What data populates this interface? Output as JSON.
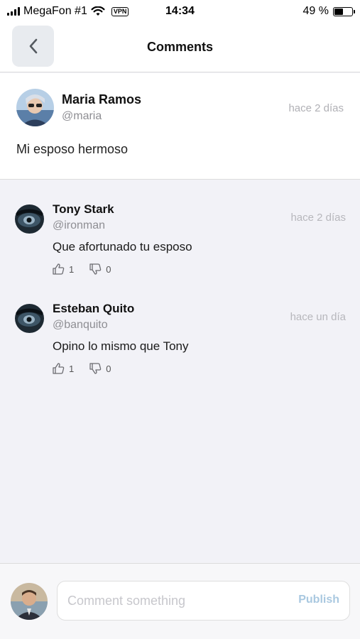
{
  "status_bar": {
    "carrier": "MegaFon #1",
    "vpn": "VPN",
    "time": "14:34",
    "battery": "49 %",
    "battery_level": 0.49,
    "icons": [
      "signal-icon",
      "wifi-icon",
      "battery-icon"
    ]
  },
  "header": {
    "title": "Comments",
    "back_icon": "chevron-left-icon"
  },
  "post": {
    "author_name": "Maria Ramos",
    "author_handle": "@maria",
    "time": "hace 2 días",
    "text": "Mi esposo hermoso"
  },
  "comments": [
    {
      "author_name": "Tony Stark",
      "author_handle": "@ironman",
      "time": "hace 2 días",
      "text": "Que afortunado tu esposo",
      "likes": "1",
      "dislikes": "0"
    },
    {
      "author_name": "Esteban Quito",
      "author_handle": "@banquito",
      "time": "hace un día",
      "text": "Opino lo mismo que Tony",
      "likes": "1",
      "dislikes": "0"
    }
  ],
  "composer": {
    "placeholder": "Comment something",
    "value": "",
    "publish_label": "Publish"
  },
  "colors": {
    "accent_disabled": "#a9c8e0",
    "background": "#f2f2f7",
    "back_button_bg": "#e8ebef"
  }
}
